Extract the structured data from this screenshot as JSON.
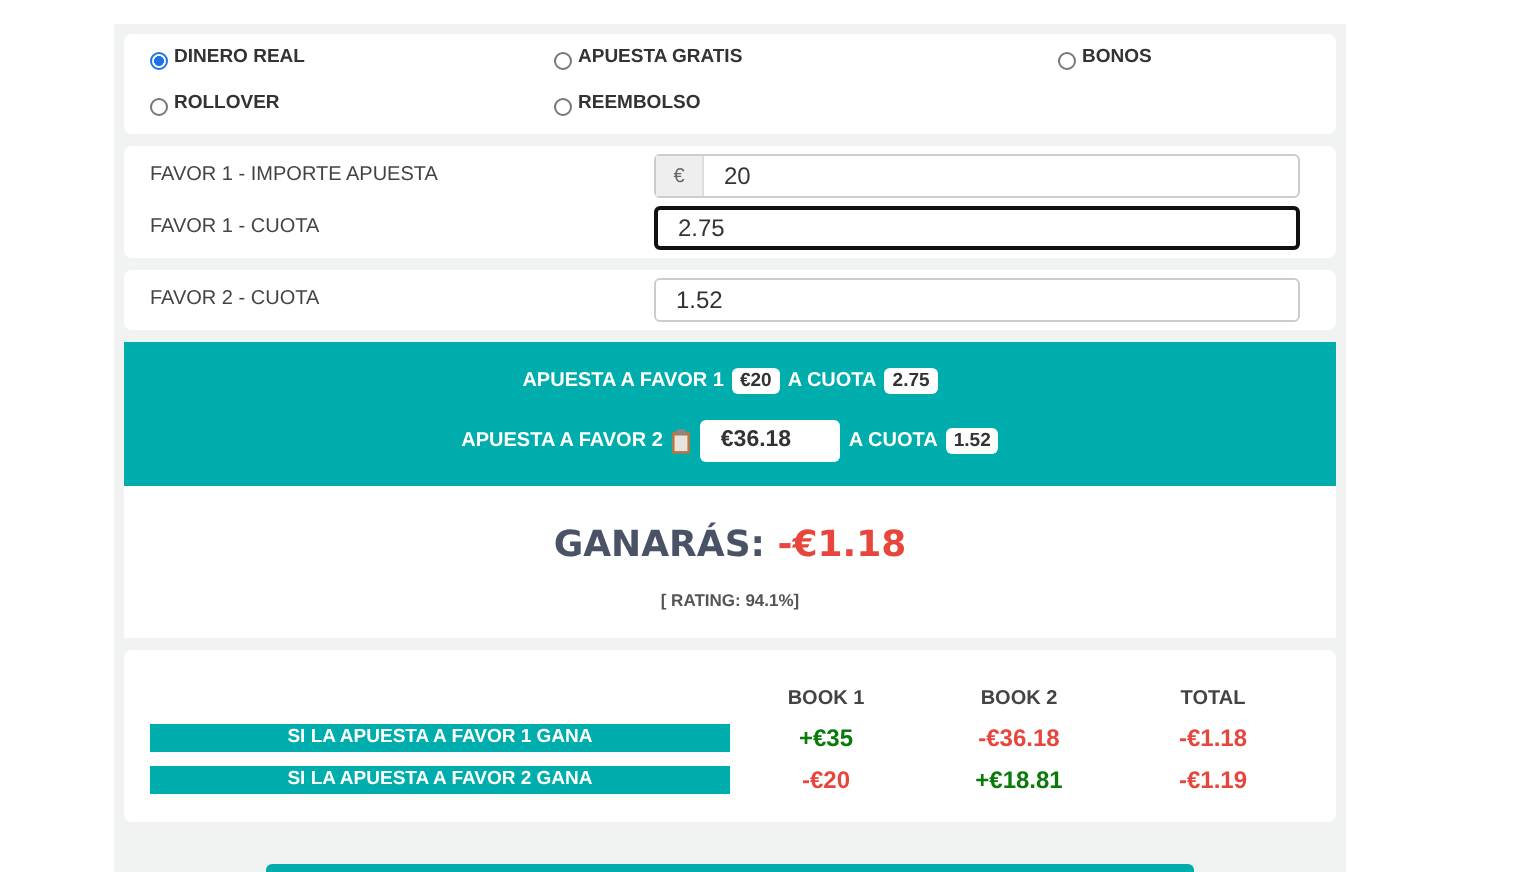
{
  "options": [
    {
      "label": "DINERO REAL",
      "selected": true
    },
    {
      "label": "APUESTA GRATIS",
      "selected": false
    },
    {
      "label": "BONOS",
      "selected": false
    },
    {
      "label": "ROLLOVER",
      "selected": false
    },
    {
      "label": "REEMBOLSO",
      "selected": false
    }
  ],
  "field_groups": [
    {
      "fields": [
        {
          "label": "FAVOR 1 - IMPORTE APUESTA",
          "prefix": "€",
          "value": "20",
          "focused": false
        },
        {
          "label": "FAVOR 1 - CUOTA",
          "value": "2.75",
          "focused": true
        }
      ]
    },
    {
      "fields": [
        {
          "label": "FAVOR 2 - CUOTA",
          "value": "1.52",
          "focused": false
        }
      ]
    }
  ],
  "summary": [
    {
      "label": "APUESTA A FAVOR 1",
      "amount": "€20",
      "kind": "badge",
      "odds_label": "A CUOTA",
      "odds": "2.75"
    },
    {
      "label": "APUESTA A FAVOR 2",
      "amount": "€36.18",
      "kind": "input",
      "odds_label": "A CUOTA",
      "odds": "1.52"
    }
  ],
  "result": {
    "label": "GANARÁS:",
    "value": "-€1.18",
    "rating": "[ RATING: 94.1%]"
  },
  "table": {
    "columns": [
      "BOOK 1",
      "BOOK 2",
      "TOTAL"
    ],
    "rows": [
      {
        "label": "SI LA APUESTA A FAVOR 1 GANA",
        "cells": [
          {
            "text": "+€35",
            "kind": "positive"
          },
          {
            "text": "-€36.18",
            "kind": "negative"
          },
          {
            "text": "-€1.18",
            "kind": "negative"
          }
        ]
      },
      {
        "label": "SI LA APUESTA A FAVOR 2 GANA",
        "cells": [
          {
            "text": "-€20",
            "kind": "negative"
          },
          {
            "text": "+€18.81",
            "kind": "positive"
          },
          {
            "text": "-€1.19",
            "kind": "negative"
          }
        ]
      }
    ]
  }
}
